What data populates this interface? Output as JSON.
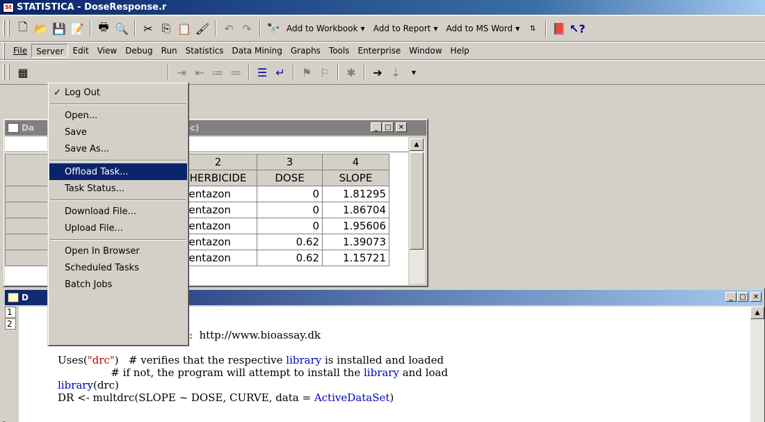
{
  "window": {
    "title": "STATISTICA - DoseResponse.r"
  },
  "toolbar1": {
    "add_to_workbook": "Add to Workbook",
    "add_to_report": "Add to Report",
    "add_to_msword": "Add to MS Word"
  },
  "menubar": {
    "items": [
      "File",
      "Server",
      "Edit",
      "View",
      "Debug",
      "Run",
      "Statistics",
      "Data Mining",
      "Graphs",
      "Tools",
      "Enterprise",
      "Window",
      "Help"
    ]
  },
  "server_menu": {
    "items": [
      {
        "label": "Log Out",
        "checked": true
      },
      {
        "label": "Open..."
      },
      {
        "label": "Save"
      },
      {
        "label": "Save As..."
      },
      {
        "label": "Offload Task...",
        "highlighted": true
      },
      {
        "label": "Task Status..."
      },
      {
        "label": "Download File..."
      },
      {
        "label": "Upload File..."
      },
      {
        "label": "Open In Browser"
      },
      {
        "label": "Scheduled Tasks"
      },
      {
        "label": "Batch Jobs"
      }
    ]
  },
  "data_window": {
    "title_left": "Da",
    "title_right": "05c)",
    "columns": [
      {
        "num": "2",
        "name": "HERBICIDE"
      },
      {
        "num": "3",
        "name": "DOSE"
      },
      {
        "num": "4",
        "name": "SLOPE"
      }
    ],
    "rows": [
      [
        "bentazon",
        "0",
        "1.81295"
      ],
      [
        "bentazon",
        "0",
        "1.86704"
      ],
      [
        "bentazon",
        "0",
        "1.95606"
      ],
      [
        "bentazon",
        "0.62",
        "1.39073"
      ],
      [
        "bentazon",
        "0.62",
        "1.15721"
      ]
    ]
  },
  "script_window": {
    "title": "D",
    "gutter": [
      "1",
      "2"
    ],
    "lines": {
      "l1_prefix": "e:  ",
      "l1_url": "http://www.bioassay.dk",
      "l2_a": "Uses(",
      "l2_str": "\"drc\"",
      "l2_b": ")   # verifies that the respective ",
      "l2_kw": "library",
      "l2_c": " is installed and loaded",
      "l3_a": "                # if not, the program will attempt to install the ",
      "l3_kw": "library",
      "l3_b": " and load",
      "l4_kw": "library",
      "l4_b": "(drc)",
      "l5_a": "DR <- multdrc(SLOPE ~ DOSE, CURVE, data = ",
      "l5_kw": "ActiveDataSet",
      "l5_b": ")"
    }
  }
}
